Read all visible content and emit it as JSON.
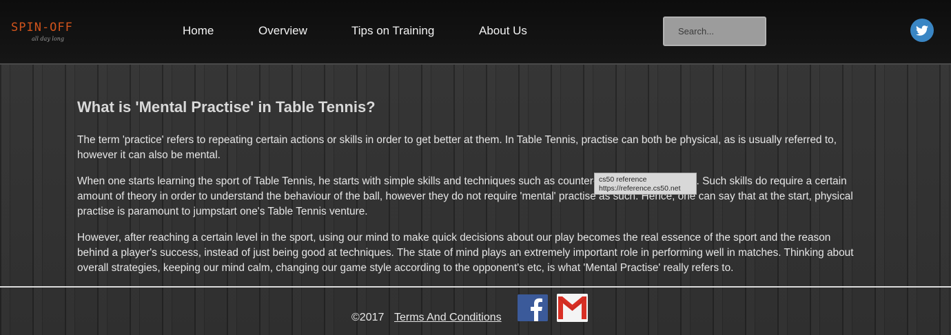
{
  "header": {
    "logo_title": "SPIN-OFF",
    "logo_subtitle": "all day long",
    "nav": [
      {
        "label": "Home"
      },
      {
        "label": "Overview"
      },
      {
        "label": "Tips on Training"
      },
      {
        "label": "About Us"
      }
    ],
    "search_placeholder": "Search...",
    "social_icon": "twitter-icon"
  },
  "main": {
    "heading": "What is 'Mental Practise' in Table Tennis?",
    "paragraphs": [
      "The term 'practice' refers to repeating certain actions or skills in order to get better at them. In Table Tennis, practise can both be physical, as is usually referred to, however it can also be mental.",
      "When one starts learning the sport of Table Tennis, he starts with simple skills and techniques such as counter-hits, loops and chops. Such skills do require a certain amount of theory in order to understand the behaviour of the ball, however they do not require 'mental' practise as such. Hence, one can say that at the start, physical practise is paramount to jumpstart one's Table Tennis venture.",
      "However, after reaching a certain level in the sport, using our mind to make quick decisions about our play becomes the real essence of the sport and the reason behind a player's success, instead of just being good at techniques. The state of mind plays an extremely important role in performing well in matches. Thinking about overall strategies, keeping our mind calm, changing our game style according to the opponent's etc, is what 'Mental Practise' really refers to."
    ],
    "tooltip": {
      "line1": "cs50 reference",
      "line2": "https://reference.cs50.net"
    }
  },
  "footer": {
    "copyright": "©2017",
    "terms_label": "Terms And Conditions",
    "icons": [
      "facebook-icon",
      "gmail-icon"
    ]
  },
  "colors": {
    "logo": "#d2541c",
    "twitter": "#3a86c4",
    "facebook": "#3b5a9a",
    "gmail_red": "#d93025"
  }
}
